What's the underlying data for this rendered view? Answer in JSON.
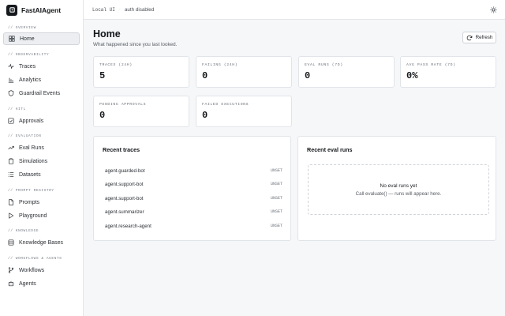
{
  "app": {
    "name": "FastAIAgent"
  },
  "topbar": {
    "env": "Local UI",
    "separator": "·",
    "auth": "auth disabled"
  },
  "sidebar": {
    "sections": [
      {
        "title": "// OVERVIEW"
      },
      {
        "title": "// OBSERVABILITY"
      },
      {
        "title": "// HITL"
      },
      {
        "title": "// EVALUATION"
      },
      {
        "title": "// PROMPT REGISTRY"
      },
      {
        "title": "// KNOWLEDGE"
      },
      {
        "title": "// WORKFLOWS & AGENTS"
      }
    ],
    "items": [
      {
        "label": "Home",
        "icon": "grid-icon"
      },
      {
        "label": "Traces",
        "icon": "activity-icon"
      },
      {
        "label": "Analytics",
        "icon": "bar-chart-icon"
      },
      {
        "label": "Guardrail Events",
        "icon": "shield-icon"
      },
      {
        "label": "Approvals",
        "icon": "check-square-icon"
      },
      {
        "label": "Eval Runs",
        "icon": "trending-up-icon"
      },
      {
        "label": "Simulations",
        "icon": "clipboard-icon"
      },
      {
        "label": "Datasets",
        "icon": "list-icon"
      },
      {
        "label": "Prompts",
        "icon": "file-icon"
      },
      {
        "label": "Playground",
        "icon": "play-icon"
      },
      {
        "label": "Knowledge Bases",
        "icon": "database-icon"
      },
      {
        "label": "Workflows",
        "icon": "git-branch-icon"
      },
      {
        "label": "Agents",
        "icon": "bot-icon"
      }
    ]
  },
  "main": {
    "title": "Home",
    "subtitle": "What happened since you last looked.",
    "refresh_label": "Refresh",
    "stats": [
      {
        "label": "TRACES (24H)",
        "value": "5"
      },
      {
        "label": "FAILING (24H)",
        "value": "0"
      },
      {
        "label": "EVAL RUNS (7D)",
        "value": "0"
      },
      {
        "label": "AVG PASS RATE (7D)",
        "value": "0%"
      },
      {
        "label": "PENDING APPROVALS",
        "value": "0"
      },
      {
        "label": "FAILED EXECUTIONS",
        "value": "0"
      }
    ],
    "recent_traces": {
      "title": "Recent traces",
      "rows": [
        {
          "name": "agent.guarded-bot",
          "status": "UNSET"
        },
        {
          "name": "agent.support-bot",
          "status": "UNSET"
        },
        {
          "name": "agent.support-bot",
          "status": "UNSET"
        },
        {
          "name": "agent.summarizer",
          "status": "UNSET"
        },
        {
          "name": "agent.research-agent",
          "status": "UNSET"
        }
      ]
    },
    "recent_evals": {
      "title": "Recent eval runs",
      "empty_title": "No eval runs yet",
      "empty_desc": "Call evaluate() — runs will appear here."
    }
  }
}
